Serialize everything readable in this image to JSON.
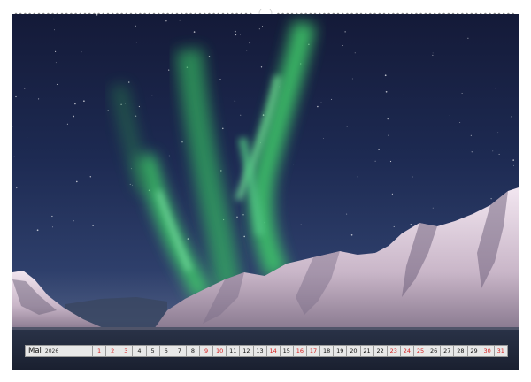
{
  "calendar": {
    "month": "Mai",
    "year": "2026",
    "days": [
      "1",
      "2",
      "3",
      "4",
      "5",
      "6",
      "7",
      "8",
      "9",
      "10",
      "11",
      "12",
      "13",
      "14",
      "15",
      "16",
      "17",
      "18",
      "19",
      "20",
      "21",
      "22",
      "23",
      "24",
      "25",
      "26",
      "27",
      "28",
      "29",
      "30",
      "31"
    ],
    "red_days": [
      1,
      2,
      3,
      9,
      10,
      14,
      16,
      17,
      23,
      24,
      25,
      30,
      31
    ]
  },
  "colors": {
    "sky_top": "#141a38",
    "sky_horizon": "#4a5a80",
    "aurora": "#3fcf6a",
    "snow": "#e8dce8",
    "holiday_red": "#d62020"
  },
  "icons": [
    "binding-hole-icon"
  ]
}
